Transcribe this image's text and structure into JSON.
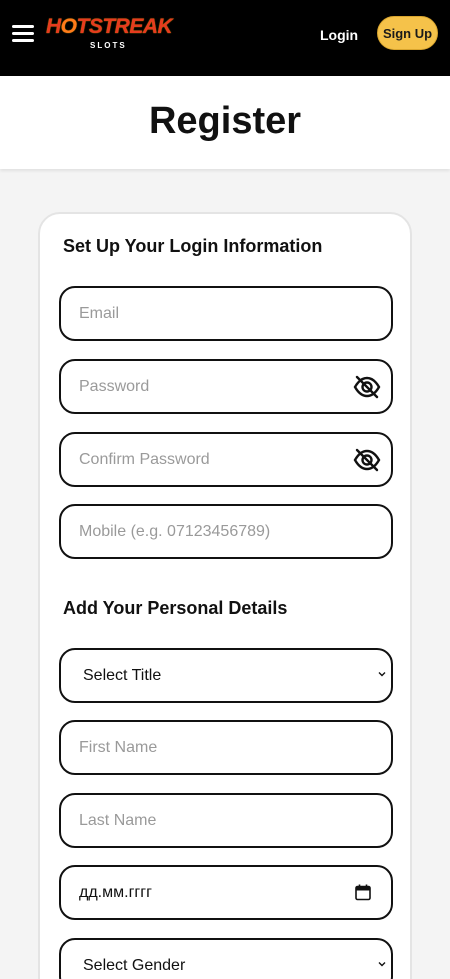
{
  "header": {
    "logo_text_hot": "H",
    "logo_text_o": "O",
    "logo_text_rest": "TSTREAK",
    "logo_sub": "SLOTS",
    "login_label": "Login",
    "signup_label": "Sign Up"
  },
  "page": {
    "title": "Register"
  },
  "login_section": {
    "title": "Set Up Your Login Information",
    "email_placeholder": "Email",
    "password_placeholder": "Password",
    "confirm_placeholder": "Confirm Password",
    "mobile_placeholder": "Mobile (e.g. 07123456789)"
  },
  "personal_section": {
    "title": "Add Your Personal Details",
    "title_select": "Select Title",
    "first_name_placeholder": "First Name",
    "last_name_placeholder": "Last Name",
    "dob_value": "дд.мм.гггг",
    "gender_select": "Select Gender"
  },
  "colors": {
    "topbar": "#000000",
    "signup_bg": "#f5c24a",
    "logo_red": "#e63b1f",
    "field_border": "#111111",
    "placeholder": "#9a9a9a"
  },
  "icons": [
    "menu-icon",
    "eye-slash-icon",
    "calendar-icon",
    "chevron-down-icon"
  ]
}
